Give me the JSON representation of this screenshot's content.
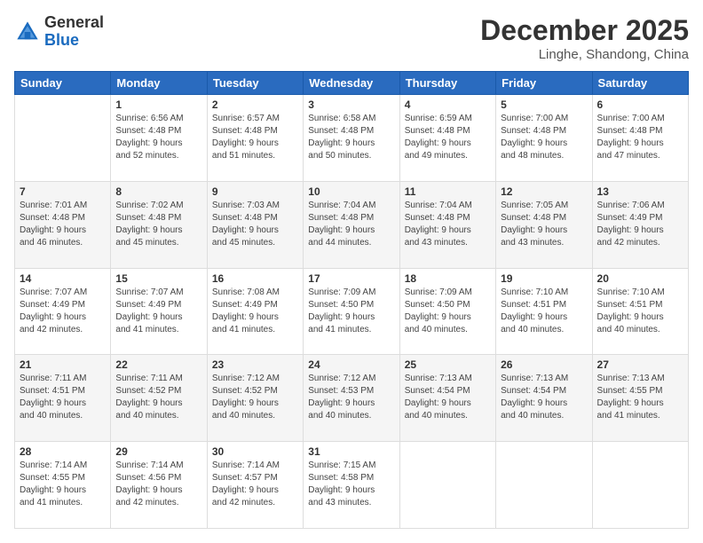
{
  "logo": {
    "line1": "General",
    "line2": "Blue"
  },
  "header": {
    "month": "December 2025",
    "location": "Linghe, Shandong, China"
  },
  "days": [
    "Sunday",
    "Monday",
    "Tuesday",
    "Wednesday",
    "Thursday",
    "Friday",
    "Saturday"
  ],
  "weeks": [
    [
      {
        "day": "",
        "info": ""
      },
      {
        "day": "1",
        "info": "Sunrise: 6:56 AM\nSunset: 4:48 PM\nDaylight: 9 hours\nand 52 minutes."
      },
      {
        "day": "2",
        "info": "Sunrise: 6:57 AM\nSunset: 4:48 PM\nDaylight: 9 hours\nand 51 minutes."
      },
      {
        "day": "3",
        "info": "Sunrise: 6:58 AM\nSunset: 4:48 PM\nDaylight: 9 hours\nand 50 minutes."
      },
      {
        "day": "4",
        "info": "Sunrise: 6:59 AM\nSunset: 4:48 PM\nDaylight: 9 hours\nand 49 minutes."
      },
      {
        "day": "5",
        "info": "Sunrise: 7:00 AM\nSunset: 4:48 PM\nDaylight: 9 hours\nand 48 minutes."
      },
      {
        "day": "6",
        "info": "Sunrise: 7:00 AM\nSunset: 4:48 PM\nDaylight: 9 hours\nand 47 minutes."
      }
    ],
    [
      {
        "day": "7",
        "info": "Sunrise: 7:01 AM\nSunset: 4:48 PM\nDaylight: 9 hours\nand 46 minutes."
      },
      {
        "day": "8",
        "info": "Sunrise: 7:02 AM\nSunset: 4:48 PM\nDaylight: 9 hours\nand 45 minutes."
      },
      {
        "day": "9",
        "info": "Sunrise: 7:03 AM\nSunset: 4:48 PM\nDaylight: 9 hours\nand 45 minutes."
      },
      {
        "day": "10",
        "info": "Sunrise: 7:04 AM\nSunset: 4:48 PM\nDaylight: 9 hours\nand 44 minutes."
      },
      {
        "day": "11",
        "info": "Sunrise: 7:04 AM\nSunset: 4:48 PM\nDaylight: 9 hours\nand 43 minutes."
      },
      {
        "day": "12",
        "info": "Sunrise: 7:05 AM\nSunset: 4:48 PM\nDaylight: 9 hours\nand 43 minutes."
      },
      {
        "day": "13",
        "info": "Sunrise: 7:06 AM\nSunset: 4:49 PM\nDaylight: 9 hours\nand 42 minutes."
      }
    ],
    [
      {
        "day": "14",
        "info": "Sunrise: 7:07 AM\nSunset: 4:49 PM\nDaylight: 9 hours\nand 42 minutes."
      },
      {
        "day": "15",
        "info": "Sunrise: 7:07 AM\nSunset: 4:49 PM\nDaylight: 9 hours\nand 41 minutes."
      },
      {
        "day": "16",
        "info": "Sunrise: 7:08 AM\nSunset: 4:49 PM\nDaylight: 9 hours\nand 41 minutes."
      },
      {
        "day": "17",
        "info": "Sunrise: 7:09 AM\nSunset: 4:50 PM\nDaylight: 9 hours\nand 41 minutes."
      },
      {
        "day": "18",
        "info": "Sunrise: 7:09 AM\nSunset: 4:50 PM\nDaylight: 9 hours\nand 40 minutes."
      },
      {
        "day": "19",
        "info": "Sunrise: 7:10 AM\nSunset: 4:51 PM\nDaylight: 9 hours\nand 40 minutes."
      },
      {
        "day": "20",
        "info": "Sunrise: 7:10 AM\nSunset: 4:51 PM\nDaylight: 9 hours\nand 40 minutes."
      }
    ],
    [
      {
        "day": "21",
        "info": "Sunrise: 7:11 AM\nSunset: 4:51 PM\nDaylight: 9 hours\nand 40 minutes."
      },
      {
        "day": "22",
        "info": "Sunrise: 7:11 AM\nSunset: 4:52 PM\nDaylight: 9 hours\nand 40 minutes."
      },
      {
        "day": "23",
        "info": "Sunrise: 7:12 AM\nSunset: 4:52 PM\nDaylight: 9 hours\nand 40 minutes."
      },
      {
        "day": "24",
        "info": "Sunrise: 7:12 AM\nSunset: 4:53 PM\nDaylight: 9 hours\nand 40 minutes."
      },
      {
        "day": "25",
        "info": "Sunrise: 7:13 AM\nSunset: 4:54 PM\nDaylight: 9 hours\nand 40 minutes."
      },
      {
        "day": "26",
        "info": "Sunrise: 7:13 AM\nSunset: 4:54 PM\nDaylight: 9 hours\nand 40 minutes."
      },
      {
        "day": "27",
        "info": "Sunrise: 7:13 AM\nSunset: 4:55 PM\nDaylight: 9 hours\nand 41 minutes."
      }
    ],
    [
      {
        "day": "28",
        "info": "Sunrise: 7:14 AM\nSunset: 4:55 PM\nDaylight: 9 hours\nand 41 minutes."
      },
      {
        "day": "29",
        "info": "Sunrise: 7:14 AM\nSunset: 4:56 PM\nDaylight: 9 hours\nand 42 minutes."
      },
      {
        "day": "30",
        "info": "Sunrise: 7:14 AM\nSunset: 4:57 PM\nDaylight: 9 hours\nand 42 minutes."
      },
      {
        "day": "31",
        "info": "Sunrise: 7:15 AM\nSunset: 4:58 PM\nDaylight: 9 hours\nand 43 minutes."
      },
      {
        "day": "",
        "info": ""
      },
      {
        "day": "",
        "info": ""
      },
      {
        "day": "",
        "info": ""
      }
    ]
  ]
}
